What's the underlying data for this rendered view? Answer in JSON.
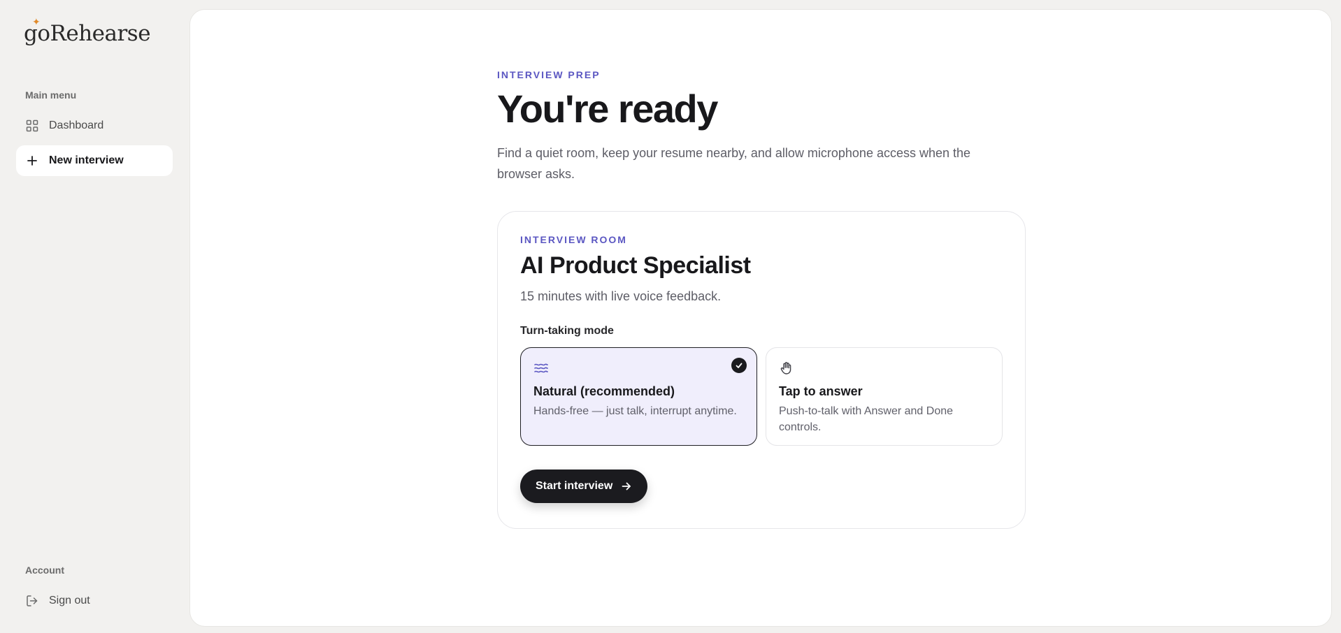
{
  "brand": {
    "name": "goRehearse",
    "accent": "#e08a2a"
  },
  "sidebar": {
    "main_menu_label": "Main menu",
    "items": [
      {
        "label": "Dashboard",
        "icon": "grid-icon"
      },
      {
        "label": "New interview",
        "icon": "plus-icon",
        "active": true
      }
    ],
    "account_label": "Account",
    "sign_out_label": "Sign out"
  },
  "page": {
    "eyebrow": "INTERVIEW PREP",
    "title": "You're ready",
    "subtitle": "Find a quiet room, keep your resume nearby, and allow microphone access when the browser asks."
  },
  "room": {
    "eyebrow": "INTERVIEW ROOM",
    "title": "AI Product Specialist",
    "subtitle": "15 minutes with live voice feedback.",
    "mode_label": "Turn-taking mode",
    "modes": [
      {
        "name": "Natural (recommended)",
        "desc": "Hands-free — just talk, interrupt anytime.",
        "icon": "waves-icon",
        "selected": true
      },
      {
        "name": "Tap to answer",
        "desc": "Push-to-talk with Answer and Done controls.",
        "icon": "hand-icon",
        "selected": false
      }
    ],
    "start_label": "Start interview"
  },
  "colors": {
    "accent": "#5b57c2",
    "selected_bg": "#f0eefc",
    "dark": "#1b1b1f"
  }
}
